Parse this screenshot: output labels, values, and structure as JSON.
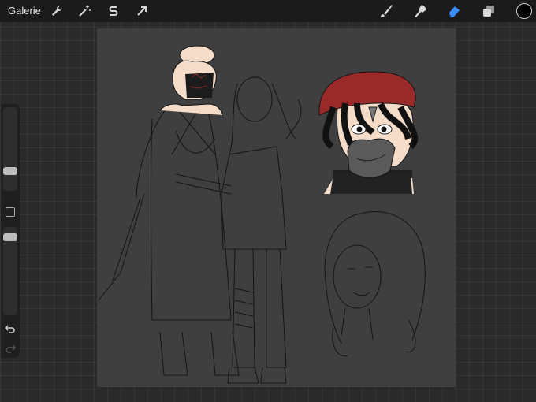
{
  "topbar": {
    "gallery_label": "Galerie",
    "tools_left": [
      "wrench-icon",
      "magic-wand-icon",
      "selection-s-icon",
      "transform-arrow-icon"
    ],
    "tools_right": [
      "brush-icon",
      "smudge-icon",
      "eraser-icon",
      "layers-icon"
    ],
    "active_tool": "eraser-icon",
    "active_color": "#000000",
    "accent_color": "#3a8dff"
  },
  "sidebar": {
    "brush_size": 0.65,
    "opacity": 0.85
  },
  "canvas": {
    "background": "#3f3f3f",
    "line_color": "#141414",
    "skin_color": "#f5dcc8",
    "beret_color": "#9a2a2a"
  }
}
